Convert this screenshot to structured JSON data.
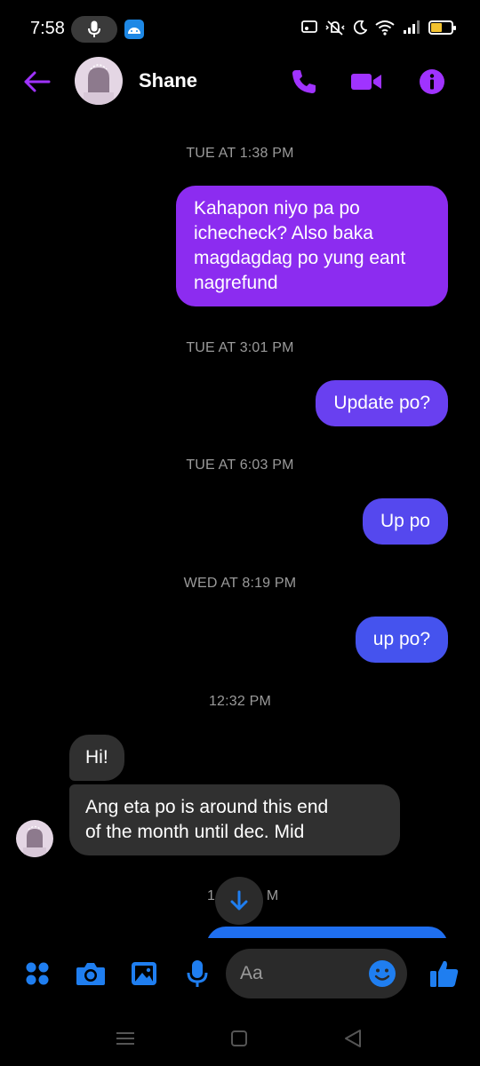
{
  "status_bar": {
    "time": "7:58"
  },
  "header": {
    "contact_name": "Shane"
  },
  "messages": {
    "ts1": "TUE AT 1:38 PM",
    "m1_line1": "Kahapon niyo pa po",
    "m1_line2": "ichecheck? Also baka",
    "m1_line3": "magdagdag po yung eant",
    "m1_line4": "nagrefund",
    "ts2": "TUE AT 3:01 PM",
    "m2": "Update po?",
    "ts3": "TUE AT 6:03 PM",
    "m3": "Up po",
    "ts4": "WED AT 8:19 PM",
    "m4": "up po?",
    "ts5": "12:32 PM",
    "m5": "Hi!",
    "m6_line1": "Ang eta po is around this end",
    "m6_line2": "of the month until dec. Mid",
    "partial_ts_left": "1",
    "partial_ts_right": "M"
  },
  "composer": {
    "placeholder": "Aa"
  },
  "colors": {
    "accent": "#a033ff",
    "bubble_purple": "#8c2cf0",
    "bubble_indigo": "#6940f0",
    "bubble_blue": "#4553ee",
    "incoming_bubble": "#303030",
    "composer_blue": "#1f7ef0"
  },
  "icons": {
    "back": "arrow-left",
    "call": "phone",
    "video": "video-camera",
    "info": "info",
    "more": "four-dots",
    "camera": "camera",
    "gallery": "image",
    "mic": "microphone",
    "emoji": "smiley",
    "like": "thumbs-up",
    "scroll": "arrow-down"
  }
}
